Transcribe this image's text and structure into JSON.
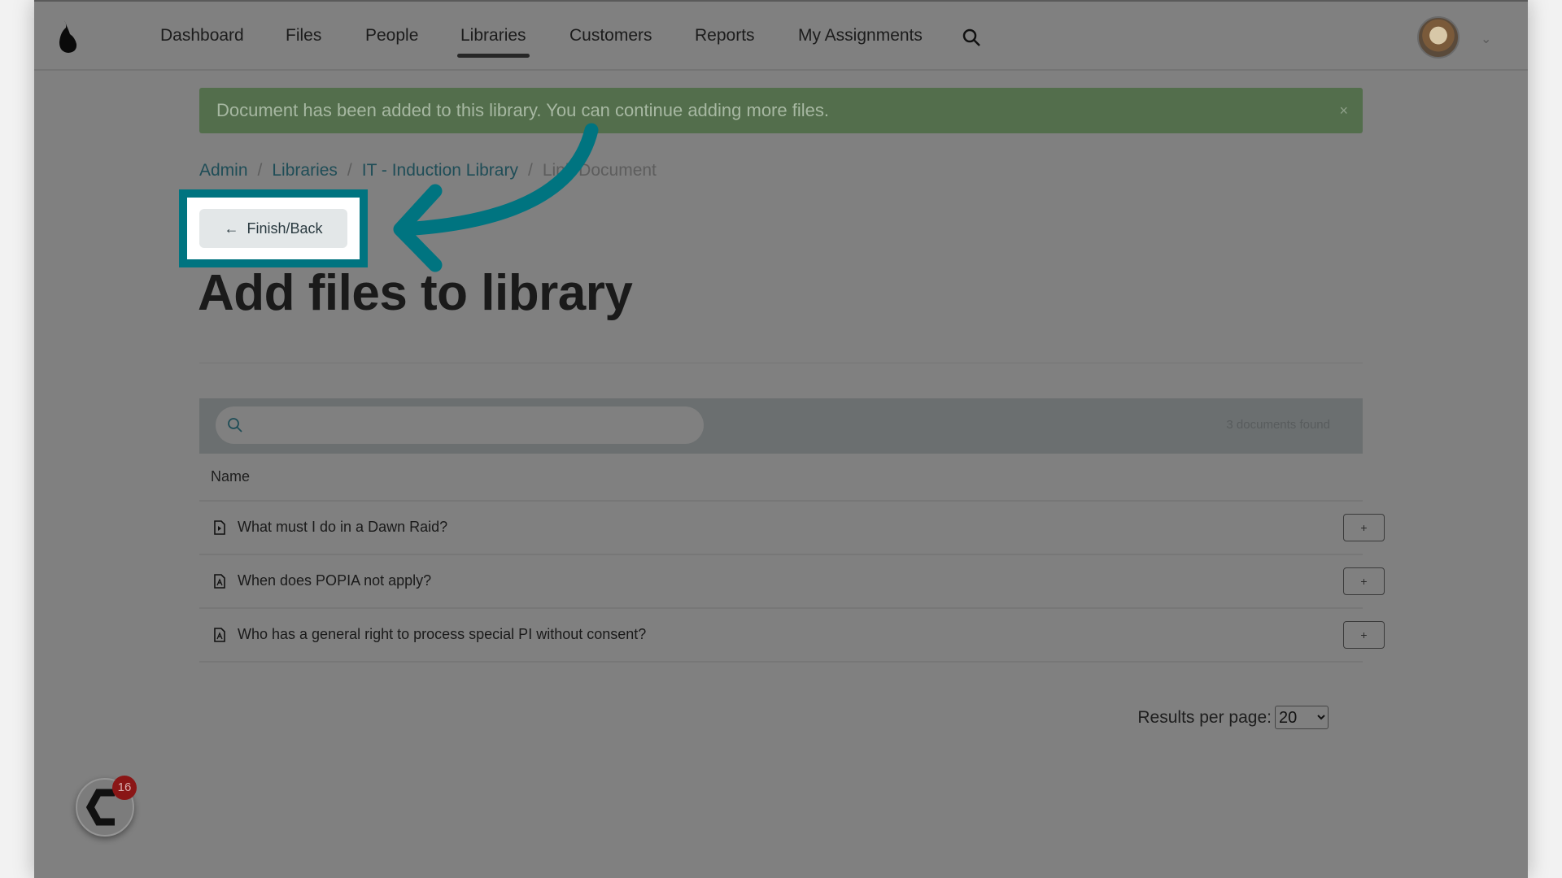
{
  "nav": {
    "items": [
      {
        "label": "Dashboard",
        "active": false
      },
      {
        "label": "Files",
        "active": false
      },
      {
        "label": "People",
        "active": false
      },
      {
        "label": "Libraries",
        "active": true
      },
      {
        "label": "Customers",
        "active": false
      },
      {
        "label": "Reports",
        "active": false
      },
      {
        "label": "My Assignments",
        "active": false
      }
    ]
  },
  "alert": {
    "message": "Document has been added to this library. You can continue adding more files.",
    "close": "×"
  },
  "breadcrumb": [
    "Admin",
    "Libraries",
    "IT - Induction Library",
    "Link Document"
  ],
  "back_button": {
    "arrow": "←",
    "label": "Finish/Back"
  },
  "page_title": "Add files to library",
  "search": {
    "placeholder": "",
    "found": "3 documents found"
  },
  "table": {
    "header": "Name",
    "rows": [
      {
        "name": "What must I do in a Dawn Raid?",
        "action": "+"
      },
      {
        "name": "When does POPIA not apply?",
        "action": "+"
      },
      {
        "name": "Who has a general right to process special PI without consent?",
        "action": "+"
      }
    ]
  },
  "pagination": {
    "label": "Results per page:",
    "value": "20"
  },
  "widget": {
    "badge": "16"
  },
  "colors": {
    "highlight": "#007480",
    "alert": "#536e4c",
    "overlay": "#808080"
  }
}
